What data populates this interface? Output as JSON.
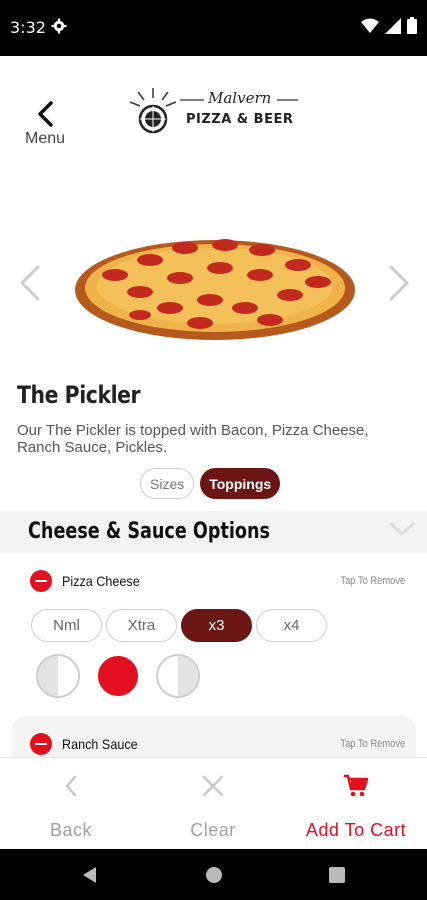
{
  "status_bar": {
    "time": "3:32"
  },
  "header": {
    "back_label": "Menu",
    "logo_name": "Malvern",
    "logo_subtitle": "PIZZA & BEER"
  },
  "item": {
    "title": "The Pickler",
    "description": "Our The Pickler is topped with Bacon, Pizza Cheese, Ranch Sauce, Pickles."
  },
  "tabs": {
    "sizes": "Sizes",
    "toppings": "Toppings"
  },
  "section": {
    "title": "Cheese & Sauce Options"
  },
  "options": [
    {
      "name": "Pizza Cheese",
      "action": "Tap To Remove"
    },
    {
      "name": "Ranch Sauce",
      "action": "Tap To Remove"
    }
  ],
  "amounts": [
    "Nml",
    "Xtra",
    "x3",
    "x4"
  ],
  "selected_amount": "x3",
  "bottom": {
    "back": "Back",
    "clear": "Clear",
    "add_to_cart": "Add To Cart"
  },
  "colors": {
    "accent_red": "#e3101f",
    "selected_maroon": "#6b1515"
  }
}
